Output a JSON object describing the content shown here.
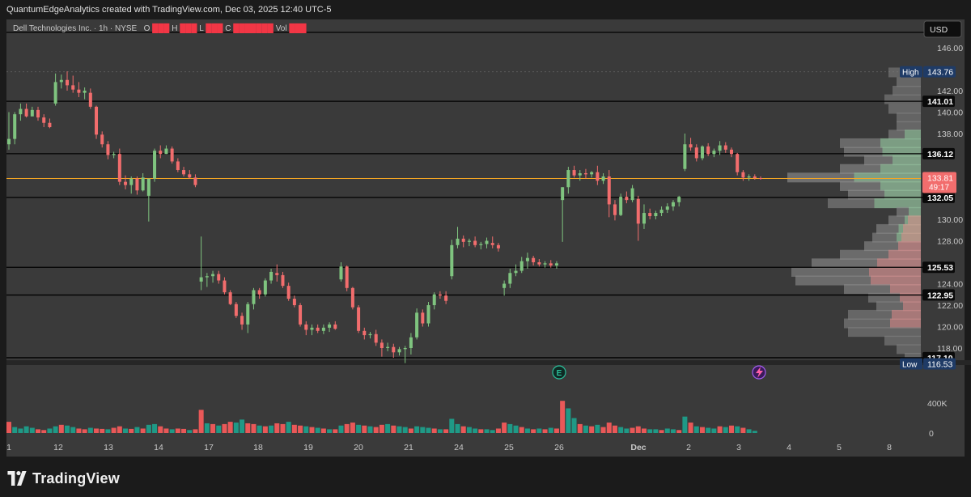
{
  "header": {
    "attribution": "QuantumEdgeAnalytics created with TradingView.com, Dec 03, 2025 12:40 UTC-5"
  },
  "legend": {
    "symbol": "Dell Technologies Inc. · 1h · NYSE",
    "o": "O",
    "h": "H",
    "l": "L",
    "c": "C",
    "vol": "Vol"
  },
  "currency": "USD",
  "footer": {
    "brand": "TradingView"
  },
  "colors": {
    "up": "#7fc47f",
    "down": "#f26d6d",
    "vol_up": "#1e9e8a",
    "vol_down": "#f25a5a",
    "current": "#f5a623"
  },
  "chart_data": {
    "type": "candlestick",
    "y_axis_ticks": [
      "146.00",
      "142.00",
      "140.00",
      "138.00",
      "130.00",
      "128.00",
      "124.00",
      "122.00",
      "120.00",
      "118.00"
    ],
    "ylim": [
      115.5,
      147.2
    ],
    "x_ticks": [
      "1",
      "12",
      "13",
      "14",
      "17",
      "18",
      "19",
      "20",
      "21",
      "24",
      "25",
      "26",
      "Dec",
      "2",
      "3",
      "4",
      "5",
      "8"
    ],
    "levels": [
      {
        "label": "141.01",
        "value": 141.01
      },
      {
        "label": "136.12",
        "value": 136.12
      },
      {
        "label": "132.05",
        "value": 132.05
      },
      {
        "label": "125.53",
        "value": 125.53
      },
      {
        "label": "122.95",
        "value": 122.95
      },
      {
        "label": "117.10",
        "value": 117.1
      }
    ],
    "high": {
      "label": "High",
      "value_text": "143.76",
      "value": 143.76
    },
    "low": {
      "label": "Low",
      "value_text": "116.53",
      "value": 116.53
    },
    "current": {
      "value_text": "133.81",
      "countdown": "49:17",
      "value": 133.81
    },
    "volume_axis": [
      "400K",
      "0"
    ],
    "events": [
      "E"
    ],
    "candles": [
      [
        137,
        140,
        136.5,
        137.5
      ],
      [
        137.5,
        140,
        137,
        139.8
      ],
      [
        139.8,
        140.8,
        139.2,
        140.3
      ],
      [
        140.3,
        140.8,
        139.5,
        139.6
      ],
      [
        139.6,
        140.5,
        139.6,
        140.2
      ],
      [
        140.2,
        140.5,
        139.2,
        139.5
      ],
      [
        139.5,
        139.8,
        138.6,
        139
      ],
      [
        139,
        139.4,
        138.5,
        138.6
      ],
      [
        140.8,
        143.6,
        140.6,
        142.8
      ],
      [
        142.8,
        143.5,
        142.2,
        143
      ],
      [
        143,
        143.8,
        142,
        142.5
      ],
      [
        142.5,
        143.4,
        141.8,
        142.1
      ],
      [
        142.1,
        142.8,
        141.4,
        141.8
      ],
      [
        141.8,
        142.3,
        141.2,
        142
      ],
      [
        141.8,
        142.2,
        140.3,
        140.5
      ],
      [
        140.5,
        140.6,
        137.5,
        137.9
      ],
      [
        137.9,
        138.2,
        136.7,
        137
      ],
      [
        137,
        137.3,
        135.6,
        136
      ],
      [
        136,
        136.3,
        135.7,
        136.1
      ],
      [
        136.1,
        136.6,
        133.2,
        133.5
      ],
      [
        133.5,
        134.1,
        132.8,
        133.2
      ],
      [
        133.2,
        134,
        132.4,
        133.8
      ],
      [
        133.8,
        134,
        132.3,
        132.7
      ],
      [
        132.7,
        134.3,
        132.6,
        133.9
      ],
      [
        132.2,
        133.8,
        129.8,
        133.8
      ],
      [
        133.8,
        136.6,
        133.5,
        136.4
      ],
      [
        136.4,
        136.9,
        135.7,
        136.1
      ],
      [
        136.1,
        136.9,
        136.1,
        136.6
      ],
      [
        136.6,
        136.8,
        135.2,
        135.4
      ],
      [
        135.4,
        135.7,
        134.4,
        134.6
      ],
      [
        134.6,
        134.9,
        134,
        134.2
      ],
      [
        134.2,
        134.6,
        133.8,
        133.9
      ],
      [
        133.9,
        134.2,
        133,
        133.2
      ],
      [
        124.2,
        128.4,
        123.4,
        124.6
      ],
      [
        124.6,
        125,
        123.7,
        124.7
      ],
      [
        124.7,
        125.2,
        124.1,
        124.9
      ],
      [
        124.9,
        125.2,
        124,
        124.3
      ],
      [
        124.3,
        124.6,
        123,
        123.2
      ],
      [
        123.2,
        123.4,
        122,
        122.1
      ],
      [
        122.1,
        122.3,
        120.8,
        121
      ],
      [
        121,
        121.3,
        119.7,
        120.2
      ],
      [
        120.2,
        122.3,
        119.4,
        122.1
      ],
      [
        122.1,
        123.6,
        121.6,
        123.4
      ],
      [
        123.4,
        123.6,
        122.6,
        123
      ],
      [
        123,
        124.5,
        122.8,
        124.3
      ],
      [
        124.3,
        125.4,
        124,
        125.1
      ],
      [
        125,
        125.8,
        124.2,
        124.8
      ],
      [
        124.8,
        125.1,
        123.6,
        123.8
      ],
      [
        123.8,
        124.1,
        122.4,
        122.6
      ],
      [
        122.6,
        122.9,
        121.8,
        122
      ],
      [
        122,
        122.2,
        120,
        120.2
      ],
      [
        120.2,
        120.5,
        119.2,
        119.7
      ],
      [
        119.7,
        120.2,
        119.2,
        119.9
      ],
      [
        119.9,
        120.2,
        119.4,
        119.6
      ],
      [
        119.6,
        120.2,
        119.3,
        119.9
      ],
      [
        119.9,
        120.4,
        119.5,
        120.2
      ],
      [
        120.2,
        120.5,
        119.7,
        119.8
      ],
      [
        124.4,
        126,
        124.2,
        125.6
      ],
      [
        125.6,
        125.7,
        123.3,
        123.6
      ],
      [
        123.6,
        123.7,
        121.6,
        121.8
      ],
      [
        121.8,
        122,
        119.4,
        119.6
      ],
      [
        119.6,
        119.9,
        118.8,
        119.2
      ],
      [
        119.2,
        119.5,
        118.9,
        119.3
      ],
      [
        119.3,
        119.7,
        118.2,
        118.5
      ],
      [
        118.5,
        118.8,
        117.2,
        118
      ],
      [
        118,
        118.5,
        117.7,
        118.1
      ],
      [
        118.1,
        118.4,
        117.1,
        117.6
      ],
      [
        117.6,
        118.1,
        117.3,
        117.9
      ],
      [
        117.9,
        118.2,
        116.6,
        118
      ],
      [
        118,
        119.4,
        117.4,
        119
      ],
      [
        119,
        121.7,
        118.8,
        121.3
      ],
      [
        121.3,
        121.6,
        120,
        120.3
      ],
      [
        120.3,
        122.3,
        120,
        122
      ],
      [
        122,
        123.2,
        121.6,
        123
      ],
      [
        123,
        123.3,
        122.6,
        122.9
      ],
      [
        122.9,
        123.3,
        122.1,
        122.4
      ],
      [
        124.7,
        128.1,
        124.4,
        127.6
      ],
      [
        127.6,
        129.3,
        127.3,
        128.2
      ],
      [
        128.2,
        128.5,
        127.4,
        127.9
      ],
      [
        127.9,
        128.2,
        127.5,
        128
      ],
      [
        128,
        128.4,
        127.4,
        127.6
      ],
      [
        127.6,
        127.9,
        127.2,
        127.7
      ],
      [
        127.7,
        128.3,
        127.3,
        128
      ],
      [
        127.8,
        128.4,
        127.3,
        127.6
      ],
      [
        127.6,
        127.8,
        127,
        127.3
      ],
      [
        123.6,
        124.3,
        122.9,
        124
      ],
      [
        124,
        125.4,
        123.6,
        125
      ],
      [
        125,
        125.8,
        124.7,
        125.2
      ],
      [
        125.2,
        126.5,
        125,
        126.1
      ],
      [
        126.1,
        126.9,
        125.4,
        126.4
      ],
      [
        126.4,
        126.6,
        125.7,
        126
      ],
      [
        126,
        126.3,
        125.6,
        125.8
      ],
      [
        125.8,
        126.1,
        125.5,
        125.9
      ],
      [
        125.9,
        126.2,
        125.5,
        125.7
      ],
      [
        125.7,
        126.1,
        125.4,
        125.9
      ],
      [
        131.8,
        133,
        127.9,
        133
      ],
      [
        133,
        134.9,
        132.4,
        134.6
      ],
      [
        134.6,
        135,
        133.9,
        134.1
      ],
      [
        134.1,
        134.6,
        133.6,
        134.3
      ],
      [
        134.3,
        134.7,
        133.8,
        134.2
      ],
      [
        134.2,
        134.5,
        133.9,
        134.4
      ],
      [
        134.4,
        135,
        133.2,
        133.6
      ],
      [
        133.6,
        134.3,
        133.3,
        134
      ],
      [
        134,
        134.6,
        130.2,
        131.4
      ],
      [
        131.4,
        131.8,
        129.9,
        130.4
      ],
      [
        130.4,
        132.4,
        130.3,
        132.1
      ],
      [
        132.1,
        132.6,
        131.5,
        131.8
      ],
      [
        131.8,
        133.2,
        131.6,
        132.9
      ],
      [
        131.9,
        132.2,
        128,
        129.6
      ],
      [
        129.6,
        131.4,
        129.1,
        130.6
      ],
      [
        130.6,
        131,
        130,
        130.3
      ],
      [
        130.3,
        130.8,
        130,
        130.6
      ],
      [
        130.6,
        131.2,
        130.3,
        130.9
      ],
      [
        130.9,
        131.5,
        130.6,
        131.2
      ],
      [
        131.2,
        131.8,
        130.8,
        131.6
      ],
      [
        131.6,
        132.2,
        131.2,
        132.1
      ],
      [
        134.7,
        138,
        134.5,
        137
      ],
      [
        137,
        137.6,
        136.4,
        136.7
      ],
      [
        136.7,
        137,
        135.4,
        135.7
      ],
      [
        135.7,
        136.9,
        135.5,
        136.8
      ],
      [
        136.8,
        137.1,
        135.9,
        136.1
      ],
      [
        136.1,
        136.6,
        135.8,
        136.4
      ],
      [
        136.4,
        137.3,
        136,
        136.9
      ],
      [
        136.9,
        137.2,
        136.2,
        136.5
      ],
      [
        136.5,
        136.7,
        135.8,
        136.1
      ],
      [
        136.1,
        136.2,
        134.1,
        134.4
      ],
      [
        134.4,
        134.6,
        133.6,
        133.9
      ],
      [
        133.9,
        134.2,
        133.6,
        134
      ],
      [
        134,
        134.2,
        133.7,
        133.85
      ],
      [
        133.85,
        134,
        133.7,
        133.81
      ]
    ],
    "volume": [
      [
        150,
        0
      ],
      [
        80,
        1
      ],
      [
        60,
        1
      ],
      [
        90,
        1
      ],
      [
        70,
        1
      ],
      [
        50,
        0
      ],
      [
        40,
        0
      ],
      [
        60,
        1
      ],
      [
        90,
        1
      ],
      [
        110,
        0
      ],
      [
        100,
        1
      ],
      [
        80,
        1
      ],
      [
        60,
        0
      ],
      [
        50,
        0
      ],
      [
        70,
        1
      ],
      [
        60,
        0
      ],
      [
        55,
        0
      ],
      [
        50,
        1
      ],
      [
        70,
        0
      ],
      [
        90,
        0
      ],
      [
        60,
        1
      ],
      [
        55,
        0
      ],
      [
        80,
        1
      ],
      [
        60,
        0
      ],
      [
        110,
        1
      ],
      [
        120,
        1
      ],
      [
        90,
        0
      ],
      [
        60,
        0
      ],
      [
        50,
        1
      ],
      [
        60,
        0
      ],
      [
        55,
        0
      ],
      [
        40,
        1
      ],
      [
        50,
        0
      ],
      [
        310,
        0
      ],
      [
        130,
        1
      ],
      [
        120,
        0
      ],
      [
        100,
        1
      ],
      [
        120,
        0
      ],
      [
        150,
        0
      ],
      [
        140,
        1
      ],
      [
        180,
        1
      ],
      [
        130,
        0
      ],
      [
        120,
        0
      ],
      [
        100,
        1
      ],
      [
        90,
        0
      ],
      [
        100,
        1
      ],
      [
        130,
        0
      ],
      [
        120,
        0
      ],
      [
        150,
        1
      ],
      [
        110,
        0
      ],
      [
        100,
        0
      ],
      [
        90,
        1
      ],
      [
        80,
        0
      ],
      [
        70,
        1
      ],
      [
        60,
        0
      ],
      [
        50,
        1
      ],
      [
        50,
        0
      ],
      [
        100,
        1
      ],
      [
        120,
        0
      ],
      [
        140,
        0
      ],
      [
        110,
        1
      ],
      [
        100,
        0
      ],
      [
        90,
        1
      ],
      [
        80,
        0
      ],
      [
        110,
        0
      ],
      [
        120,
        1
      ],
      [
        100,
        0
      ],
      [
        90,
        1
      ],
      [
        80,
        1
      ],
      [
        60,
        0
      ],
      [
        90,
        1
      ],
      [
        80,
        1
      ],
      [
        70,
        1
      ],
      [
        60,
        0
      ],
      [
        50,
        1
      ],
      [
        50,
        0
      ],
      [
        190,
        1
      ],
      [
        120,
        1
      ],
      [
        90,
        0
      ],
      [
        80,
        1
      ],
      [
        60,
        1
      ],
      [
        50,
        0
      ],
      [
        50,
        1
      ],
      [
        40,
        1
      ],
      [
        60,
        0
      ],
      [
        140,
        0
      ],
      [
        120,
        1
      ],
      [
        100,
        1
      ],
      [
        80,
        0
      ],
      [
        60,
        1
      ],
      [
        50,
        0
      ],
      [
        60,
        1
      ],
      [
        50,
        0
      ],
      [
        70,
        1
      ],
      [
        60,
        0
      ],
      [
        430,
        0
      ],
      [
        330,
        1
      ],
      [
        200,
        1
      ],
      [
        120,
        0
      ],
      [
        100,
        1
      ],
      [
        90,
        0
      ],
      [
        110,
        1
      ],
      [
        80,
        0
      ],
      [
        140,
        0
      ],
      [
        100,
        0
      ],
      [
        80,
        1
      ],
      [
        60,
        1
      ],
      [
        70,
        0
      ],
      [
        90,
        0
      ],
      [
        60,
        0
      ],
      [
        50,
        1
      ],
      [
        50,
        1
      ],
      [
        40,
        0
      ],
      [
        60,
        1
      ],
      [
        50,
        1
      ],
      [
        40,
        0
      ],
      [
        220,
        1
      ],
      [
        140,
        0
      ],
      [
        90,
        1
      ],
      [
        80,
        0
      ],
      [
        70,
        1
      ],
      [
        60,
        1
      ],
      [
        90,
        0
      ],
      [
        80,
        1
      ],
      [
        100,
        0
      ],
      [
        90,
        1
      ],
      [
        70,
        0
      ],
      [
        50,
        1
      ],
      [
        30,
        1
      ]
    ],
    "volume_profile": [
      [
        143.7,
        40,
        0.25
      ],
      [
        142.8,
        30,
        0.35
      ],
      [
        142,
        35,
        0.3
      ],
      [
        141.2,
        45,
        0.3
      ],
      [
        140.3,
        40,
        0.35
      ],
      [
        139.5,
        30,
        0.3
      ],
      [
        138.7,
        30,
        0.35
      ],
      [
        137.9,
        40,
        0.4
      ],
      [
        137.1,
        100,
        0.45
      ],
      [
        136.3,
        95,
        0.5
      ],
      [
        135.5,
        70,
        0.55
      ],
      [
        134.7,
        100,
        0.55
      ],
      [
        133.9,
        165,
        0.6
      ],
      [
        133.1,
        100,
        0.55
      ],
      [
        132.3,
        90,
        0.55
      ],
      [
        131.5,
        115,
        0.4
      ],
      [
        130.7,
        30,
        0.45
      ],
      [
        129.9,
        40,
        0.5
      ],
      [
        129.1,
        55,
        0.5
      ],
      [
        128.3,
        60,
        0.45
      ],
      [
        127.5,
        70,
        0.5
      ],
      [
        126.7,
        100,
        0.5
      ],
      [
        125.9,
        135,
        0.55
      ],
      [
        125.1,
        160,
        0.45
      ],
      [
        124.3,
        155,
        0.5
      ],
      [
        123.5,
        95,
        0.5
      ],
      [
        122.7,
        65,
        0.4
      ],
      [
        121.9,
        55,
        0.4
      ],
      [
        121.1,
        90,
        0.35
      ],
      [
        120.3,
        95,
        0.35
      ],
      [
        119.5,
        90,
        0.3
      ],
      [
        118.7,
        45,
        0.3
      ],
      [
        117.9,
        30,
        0.3
      ],
      [
        117.1,
        20,
        0.3
      ]
    ]
  }
}
